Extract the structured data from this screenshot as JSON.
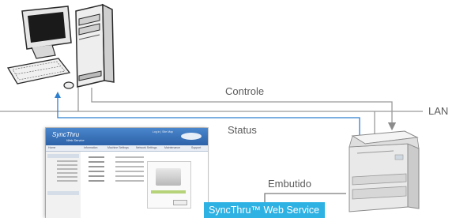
{
  "labels": {
    "controle": "Controle",
    "lan": "LAN",
    "status": "Status",
    "embutido": "Embutido",
    "web_service": "SyncThru™ Web Service"
  },
  "thumbnail": {
    "logo": "SyncThru",
    "logo_sub": "Web Service",
    "header_link": "Log in  |  Site Map",
    "tabs": [
      "Home",
      "Information",
      "Machine Settings",
      "Network Settings",
      "Maintenance",
      "Support"
    ]
  },
  "colors": {
    "line": "#9a9a9a",
    "status_arrow": "#2f7fcf",
    "badge": "#2eb1e3",
    "text": "#5a5a5a"
  },
  "icons": [
    "computer-icon",
    "printer-icon",
    "web-page-thumbnail"
  ]
}
